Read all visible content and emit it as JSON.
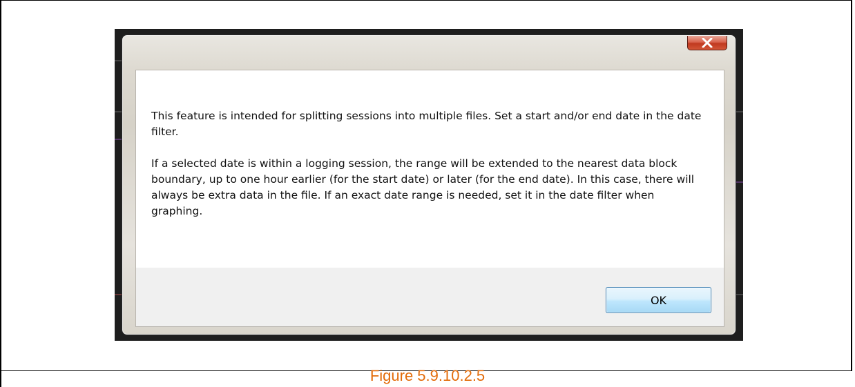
{
  "dialog": {
    "close_glyph": "x",
    "paragraphs": [
      "This feature is intended for splitting sessions into multiple files. Set a start and/or end date in the date filter.",
      "If a selected date is within a logging session, the range will be extended to the nearest data block boundary, up to one hour earlier (for the start date) or later (for the end date). In this case, there will always be extra data in the file. If an exact date range is needed, set it in the date filter when graphing."
    ],
    "ok_label": "OK"
  },
  "figure": {
    "caption": "Figure 5.9.10.2.5",
    "caption_color": "#e36c0a"
  },
  "colors": {
    "close_button": "#c8412a",
    "ok_button_border": "#3c7fb1"
  }
}
